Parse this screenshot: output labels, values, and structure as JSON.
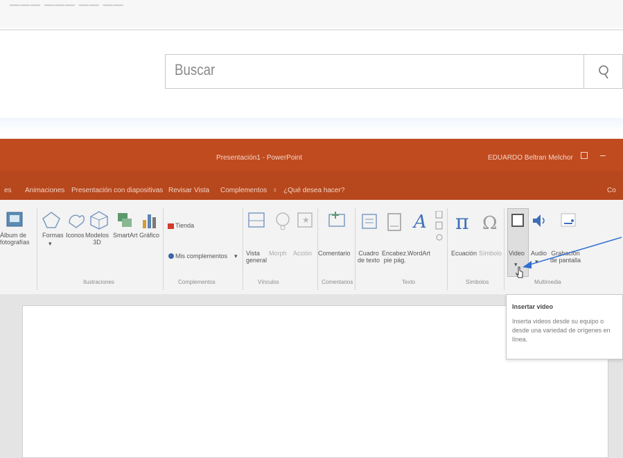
{
  "browser": {
    "top_text": "——— ——— —— ——",
    "search_placeholder": "Buscar"
  },
  "app": {
    "title": "Presentación1 - PowerPoint",
    "user": "EDUARDO Beltran Melchor",
    "share": "Co"
  },
  "tabs": [
    "es",
    "Animaciones",
    "Presentación con diapositivas",
    "Revisar",
    "Vista",
    "Complementos",
    "¿Qué desea hacer?"
  ],
  "ribbon": {
    "album": "Álbum de\nfotografías",
    "formas": "Formas",
    "iconos": "Iconos",
    "modelos": "Modelos\n3D",
    "smartart": "SmartArt",
    "grafico": "Gráfico",
    "tienda": "Tienda",
    "mis_complementos": "Mis complementos",
    "vista_general": "Vista\ngeneral",
    "morph": "Morph",
    "accion": "Acción",
    "comentario": "Comentario",
    "cuadro_texto": "Cuadro\nde texto",
    "encabez": "Encabez.\npie pág.",
    "wordart": "WordArt",
    "ecuacion": "Ecuación",
    "simbolo": "Símbolo",
    "video": "Video",
    "audio": "Audio",
    "grabacion": "Grabación\nde pantalla"
  },
  "groups": {
    "ilustraciones": "Ilustraciones",
    "complementos": "Complementos",
    "vinculos": "Vínculos",
    "comentarios": "Comentarios",
    "texto": "Texto",
    "simbolos": "Símbolos",
    "multimedia": "Multimedia"
  },
  "tooltip": {
    "title": "Insertar video",
    "description": "Inserta videos desde su equipo o desde una variedad de orígenes en línea."
  },
  "colors": {
    "titlebar": "#c04b1f",
    "ribbon": "#f3f3f3",
    "annotation_arrow": "#2f6fd1"
  }
}
